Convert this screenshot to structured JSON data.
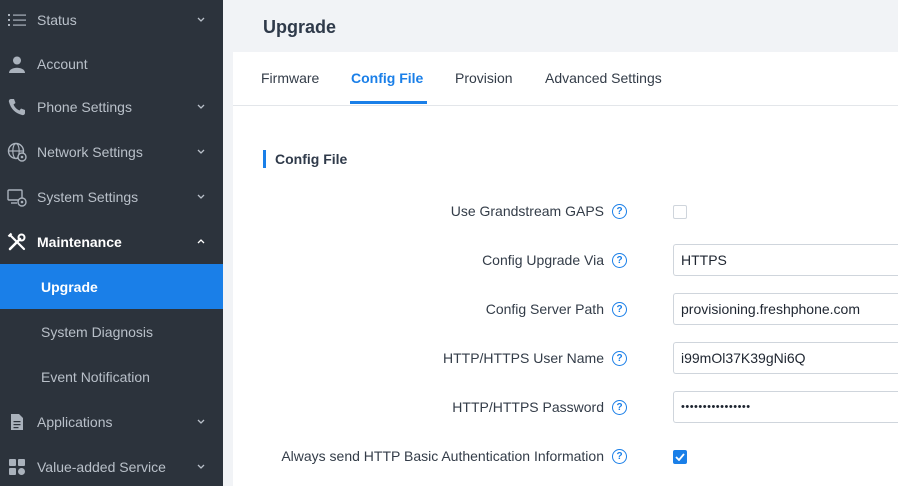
{
  "sidebar": {
    "items": [
      {
        "label": "Status",
        "icon": "list-icon"
      },
      {
        "label": "Account",
        "icon": "user-icon"
      },
      {
        "label": "Phone Settings",
        "icon": "phone-icon"
      },
      {
        "label": "Network Settings",
        "icon": "network-icon"
      },
      {
        "label": "System Settings",
        "icon": "system-settings-icon"
      },
      {
        "label": "Maintenance",
        "icon": "tools-icon"
      },
      {
        "label": "Applications",
        "icon": "document-icon"
      },
      {
        "label": "Value-added Service",
        "icon": "grid-icon"
      }
    ],
    "maintenance_sub": [
      {
        "label": "Upgrade"
      },
      {
        "label": "System Diagnosis"
      },
      {
        "label": "Event Notification"
      }
    ]
  },
  "page": {
    "title": "Upgrade"
  },
  "tabs": [
    {
      "label": "Firmware"
    },
    {
      "label": "Config File"
    },
    {
      "label": "Provision"
    },
    {
      "label": "Advanced Settings"
    }
  ],
  "section": {
    "title": "Config File"
  },
  "form": {
    "use_gaps": {
      "label": "Use Grandstream GAPS",
      "checked": false
    },
    "upgrade_via": {
      "label": "Config Upgrade Via",
      "value": "HTTPS"
    },
    "server_path": {
      "label": "Config Server Path",
      "value": "provisioning.freshphone.com"
    },
    "user_name": {
      "label": "HTTP/HTTPS User Name",
      "value": "i99mOl37K39gNi6Q"
    },
    "password": {
      "label": "HTTP/HTTPS Password",
      "value": "••••••••••••••••"
    },
    "basic_auth": {
      "label": "Always send HTTP Basic Authentication Information",
      "checked": true
    }
  },
  "help_glyph": "?",
  "colors": {
    "accent": "#1a7fe8",
    "sidebar_bg": "#2c333c",
    "sidebar_text": "#b9c0c9"
  }
}
